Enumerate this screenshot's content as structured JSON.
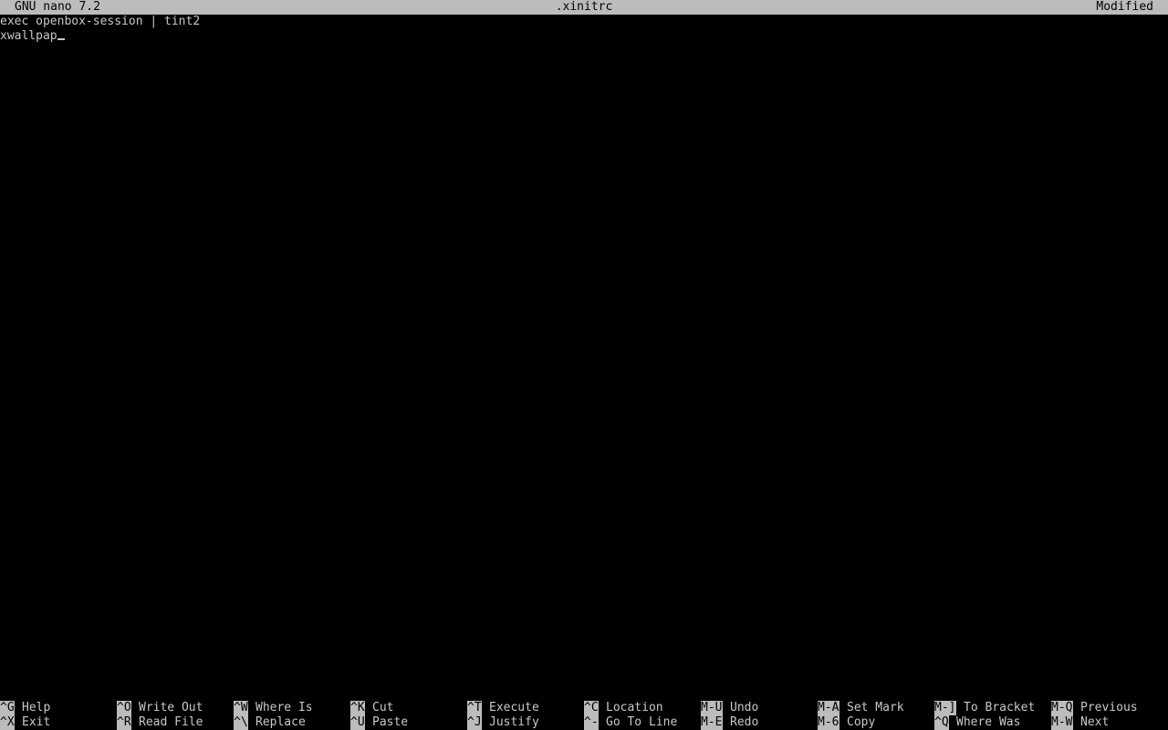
{
  "title_bar": {
    "app": "GNU nano 7.2",
    "filename": ".xinitrc",
    "status": "Modified"
  },
  "editor": {
    "lines": [
      "exec openbox-session | tint2",
      "xwallpap"
    ]
  },
  "shortcuts": {
    "row1": [
      {
        "key": "^G",
        "label": "Help"
      },
      {
        "key": "^O",
        "label": "Write Out"
      },
      {
        "key": "^W",
        "label": "Where Is"
      },
      {
        "key": "^K",
        "label": "Cut"
      },
      {
        "key": "^T",
        "label": "Execute"
      },
      {
        "key": "^C",
        "label": "Location"
      },
      {
        "key": "M-U",
        "label": "Undo"
      },
      {
        "key": "M-A",
        "label": "Set Mark"
      },
      {
        "key": "M-]",
        "label": "To Bracket"
      },
      {
        "key": "M-Q",
        "label": "Previous"
      }
    ],
    "row2": [
      {
        "key": "^X",
        "label": "Exit"
      },
      {
        "key": "^R",
        "label": "Read File"
      },
      {
        "key": "^\\",
        "label": "Replace"
      },
      {
        "key": "^U",
        "label": "Paste"
      },
      {
        "key": "^J",
        "label": "Justify"
      },
      {
        "key": "^-",
        "label": "Go To Line"
      },
      {
        "key": "M-E",
        "label": "Redo"
      },
      {
        "key": "M-6",
        "label": "Copy"
      },
      {
        "key": "^Q",
        "label": "Where Was"
      },
      {
        "key": "M-W",
        "label": "Next"
      }
    ]
  },
  "colors": {
    "background": "#000000",
    "foreground": "#c8c8c8",
    "bar": "#bcbcbc"
  }
}
